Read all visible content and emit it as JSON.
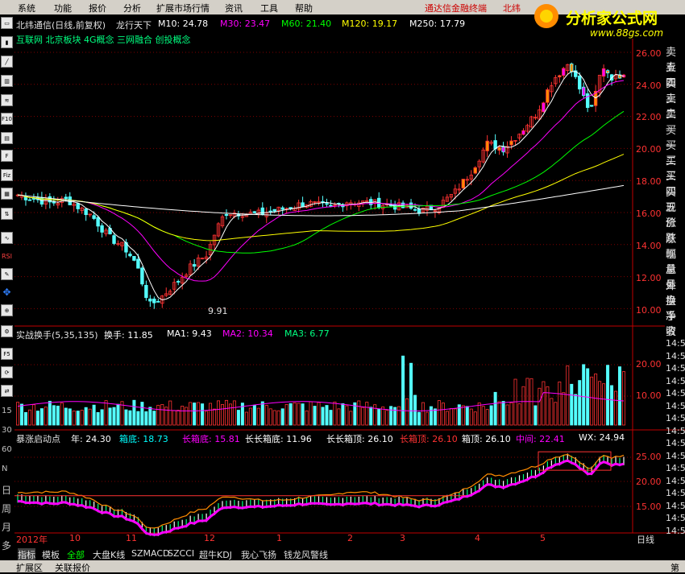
{
  "menu": {
    "items": [
      "系统",
      "功能",
      "报价",
      "分析",
      "扩展市场行情",
      "资讯",
      "工具",
      "帮助"
    ],
    "right_text": "通达信金融终端",
    "right_text2": "北纬"
  },
  "logo": {
    "title": "分析家公式网",
    "url": "www.88gs.com"
  },
  "main_header": {
    "stock": "北纬通信(日线,前复权)",
    "formula": "龙行天下",
    "m10": "M10: 24.78",
    "m30": "M30: 23.47",
    "m60": "M60: 21.40",
    "m120": "M120: 19.17",
    "m250": "M250: 17.79",
    "concepts": "互联网 北京板块 4G概念 三网融合 创投概念",
    "low_label": "9.91"
  },
  "main_axis": [
    "26.00",
    "24.00",
    "22.00",
    "20.00",
    "18.00",
    "16.00",
    "14.00",
    "12.00",
    "10.00"
  ],
  "vol_header": {
    "name": "实战换手(5,35,135)",
    "hs": "换手: 11.85",
    "ma1": "MA1: 9.43",
    "ma2": "MA2: 10.34",
    "ma3": "MA3: 6.77"
  },
  "vol_axis": [
    "20.00",
    "10.00"
  ],
  "ind_header": {
    "name": "暴涨启动点",
    "year": "年: 24.30",
    "xd": "箱底: 18.73",
    "cxd": "长箱底: 15.81",
    "ccxd": "长长箱底: 11.96",
    "ccxt": "长长箱顶: 26.10",
    "cxt": "长箱顶: 26.10",
    "xt": "箱顶: 26.10",
    "zj": "中间: 22.41",
    "wx": "WX: 24.94"
  },
  "ind_axis": [
    "25.00",
    "20.00",
    "15.00"
  ],
  "right_panel": [
    "卖五",
    "卖四",
    "卖三",
    "卖二",
    "卖一",
    "买一",
    "买二",
    "买三",
    "买四",
    "买五",
    "现价",
    "涨跌",
    "涨幅",
    "现量",
    "总量",
    "外盘",
    "换手",
    "净资",
    "收益"
  ],
  "right_axis_frag": [
    "14:5",
    "14:5",
    "14:5",
    "14:5",
    "14:5",
    "14:5",
    "14:5",
    "14:5",
    "14:5",
    "14:5",
    "14:5",
    "14:5",
    "14:5",
    "14:5",
    "14:5",
    "14:5"
  ],
  "timeline": {
    "labels": [
      "2012年",
      "10",
      "11",
      "12",
      "1",
      "2",
      "3",
      "4",
      "5"
    ],
    "period": "日线"
  },
  "footer_tabs": [
    "指标",
    "模板",
    "全部",
    "大盘K线",
    "SZMACD",
    "SZCCI",
    "超牛KDJ",
    "我心飞扬",
    "钱龙风警线"
  ],
  "status_tabs": [
    "扩展区",
    "关联报价"
  ],
  "left_labels": [
    "15",
    "30",
    "60",
    "N",
    "日",
    "周",
    "月",
    "多"
  ],
  "status_right": "第",
  "colors": {
    "up": "#ff3232",
    "down": "#54ffff",
    "m10": "#ffffff",
    "m30": "#ff00ff",
    "m60": "#00ff00",
    "m120": "#ffff00",
    "m250": "#ffffff"
  }
}
